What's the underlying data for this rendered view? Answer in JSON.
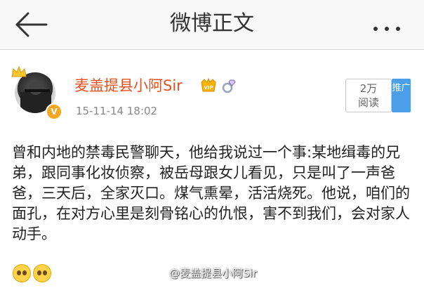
{
  "header": {
    "title": "微博正文",
    "back_icon": "arrow-left-icon",
    "more_icon": "more-dots-icon"
  },
  "post": {
    "user_name": "麦盖提县小阿Sir",
    "badges": [
      "crown-icon",
      "verified-v-icon",
      "vip-icon",
      "diamond-ring-icon"
    ],
    "verified_mark": "V",
    "time": "15-11-14 18:02",
    "reads": {
      "count": "2万",
      "label": "阅读"
    },
    "promote_label": "推广",
    "body": "曾和内地的禁毒民警聊天，他给我说过一个事:某地缉毒的兄弟，跟同事化妆侦察，被岳母跟女儿看见，只是叫了一声爸爸，三天后，全家灭口。煤气熏晕，活活烧死。他说，咱们的面孔，在对方心里是刻骨铭心的仇恨，害不到我们，会对家人动手。",
    "emojis": [
      "teary-face-icon",
      "teary-face-icon"
    ],
    "watermark": "@麦盖提县小阿Sir"
  },
  "colors": {
    "name": "#e5511f",
    "promote": "#4a9fe8",
    "badge_gold": "#f5a623"
  }
}
